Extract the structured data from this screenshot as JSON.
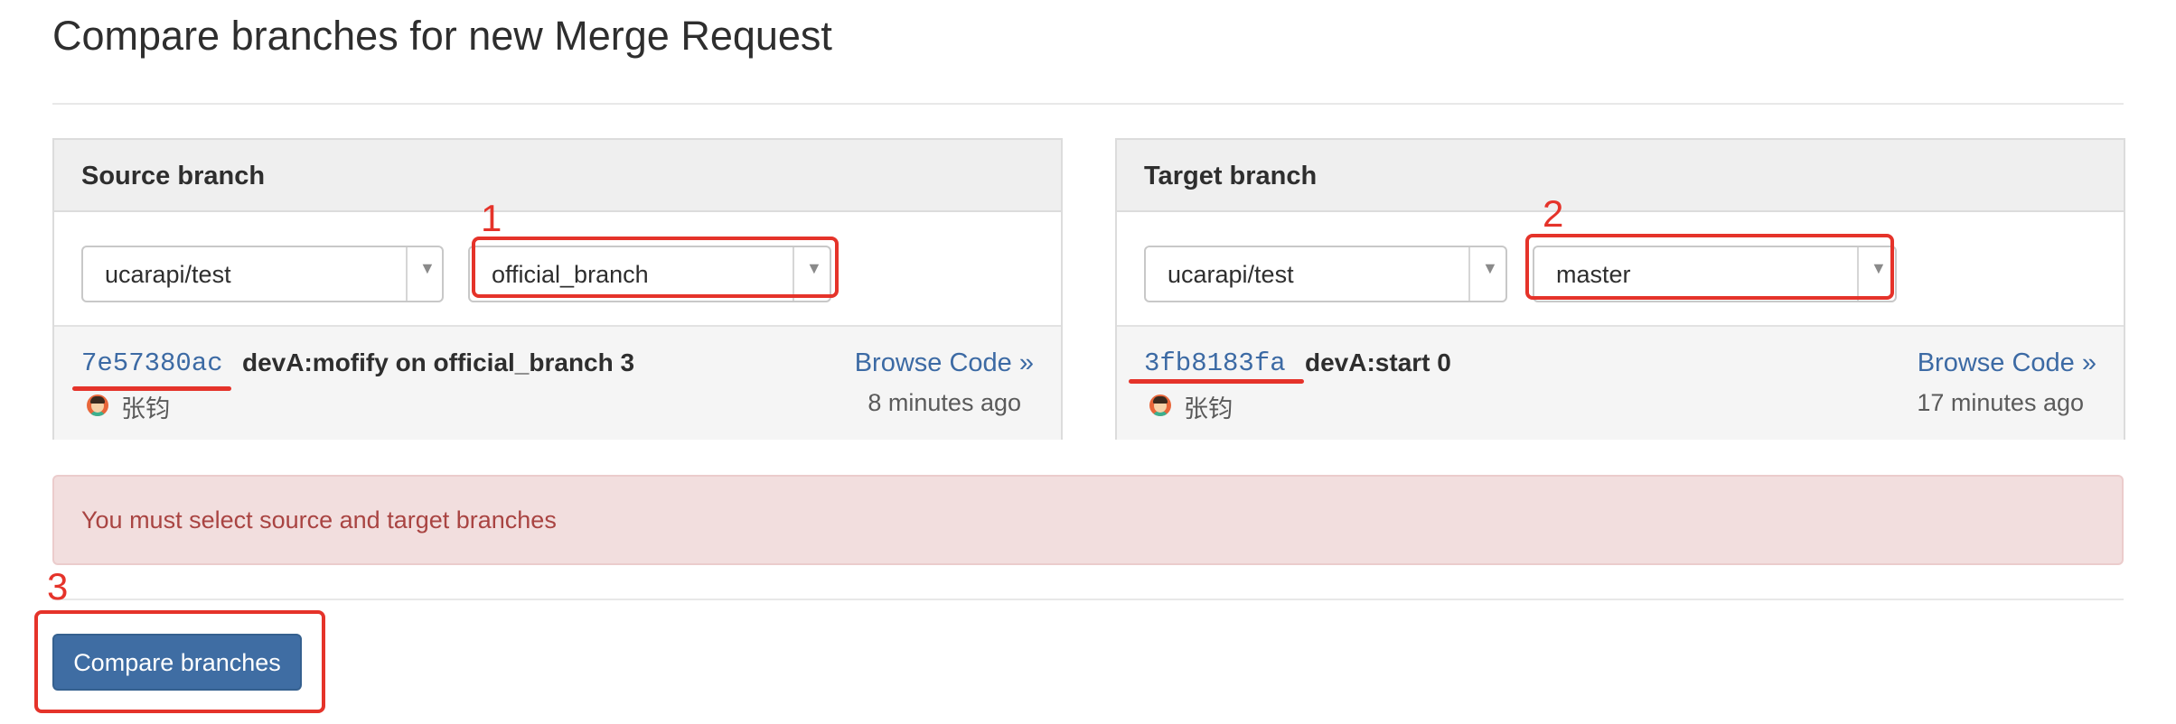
{
  "page": {
    "title": "Compare branches for new Merge Request"
  },
  "source": {
    "heading": "Source branch",
    "project": "ucarapi/test",
    "branch": "official_branch",
    "commit": {
      "sha": "7e57380ac",
      "message": "devA:mofify on official_branch 3",
      "author": "张钧",
      "time": "8 minutes ago",
      "browse_label": "Browse Code »"
    }
  },
  "target": {
    "heading": "Target branch",
    "project": "ucarapi/test",
    "branch": "master",
    "commit": {
      "sha": "3fb8183fa",
      "message": "devA:start 0",
      "author": "张钧",
      "time": "17 minutes ago",
      "browse_label": "Browse Code »"
    }
  },
  "alert": {
    "message": "You must select source and target branches"
  },
  "actions": {
    "compare_label": "Compare branches"
  },
  "annotations": {
    "one": "1",
    "two": "2",
    "three": "3"
  },
  "colors": {
    "annotation": "#e5332a",
    "link": "#3c6aa4",
    "button": "#3f6da3",
    "alert_bg": "#f2dede",
    "alert_text": "#a94442"
  }
}
